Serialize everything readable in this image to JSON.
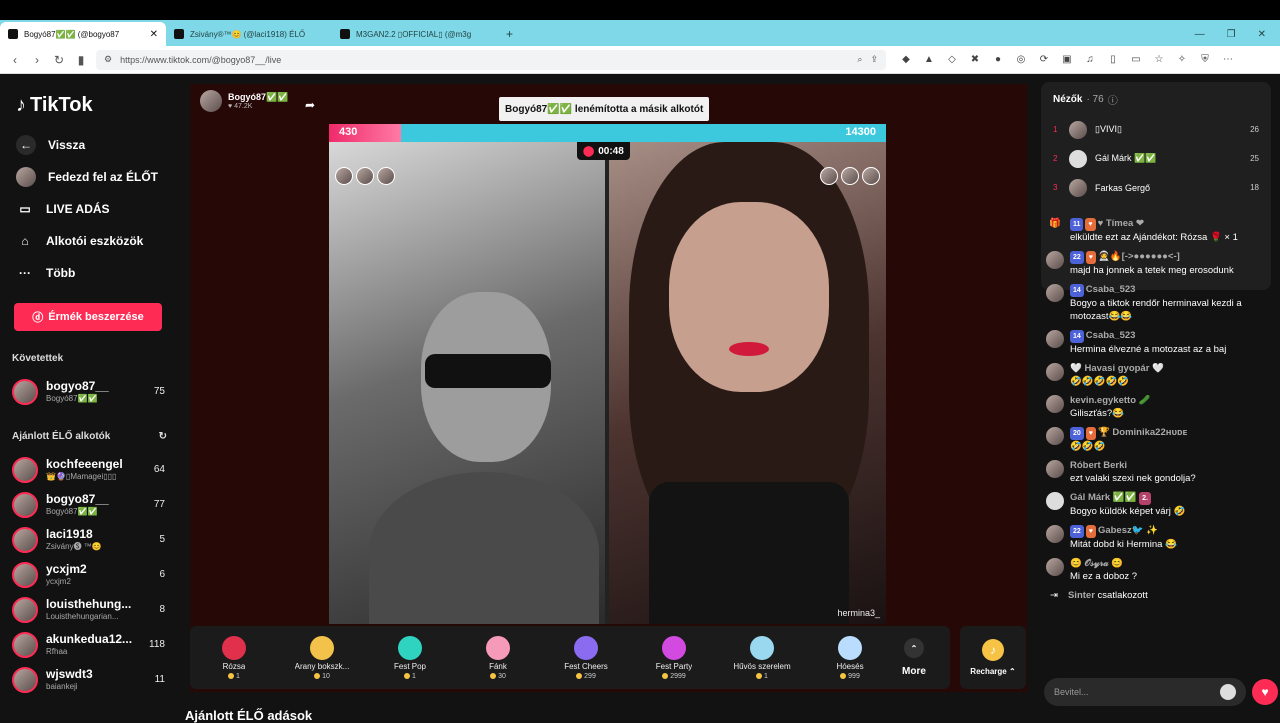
{
  "browser": {
    "tabs": [
      {
        "title": "Bogyó87✅✅ (@bogyo87",
        "active": true
      },
      {
        "title": "Zsivány®™😊 (@laci1918) ÉLŐ",
        "active": false
      },
      {
        "title": "M3GAN2.2 ▯OFFICIAL▯ (@m3g",
        "active": false
      }
    ],
    "url": "https://www.tiktok.com/@bogyo87__/live"
  },
  "sidebar": {
    "logo": "TikTok",
    "nav": [
      {
        "label": "Vissza",
        "icon": "back-arrow-icon"
      },
      {
        "label": "Fedezd fel az ÉLŐT",
        "icon": "avatar"
      },
      {
        "label": "LIVE ADÁS",
        "icon": "video-camera-icon"
      },
      {
        "label": "Alkotói eszközök",
        "icon": "home-tools-icon"
      },
      {
        "label": "Több",
        "icon": "more-dots-icon"
      }
    ],
    "coin_button": "Érmék beszerzése",
    "following_title": "Követettek",
    "following": [
      {
        "name": "bogyo87__",
        "sub": "Bogyó87✅✅",
        "count": "75"
      }
    ],
    "recommended_title": "Ajánlott ÉLŐ alkotók",
    "recommended": [
      {
        "name": "kochfeeengel",
        "sub": "👑🔮▯Mamagei▯▯▯",
        "count": "64"
      },
      {
        "name": "bogyo87__",
        "sub": "Bogyó87✅✅",
        "count": "77"
      },
      {
        "name": "laci1918",
        "sub": "Zsivány🅢 ™😊",
        "count": "5"
      },
      {
        "name": "ycxjm2",
        "sub": "ycxjm2",
        "count": "6"
      },
      {
        "name": "louisthehung...",
        "sub": "Louisthehungarian...",
        "count": "8"
      },
      {
        "name": "akunkedua12...",
        "sub": "Rfhaa",
        "count": "118"
      },
      {
        "name": "wjswdt3",
        "sub": "baiankeji",
        "count": "11"
      }
    ]
  },
  "stream": {
    "host_name": "Bogyó87✅✅",
    "host_likes": "♥ 47.2K",
    "toast": "Bogyó87✅✅ lenémította a másik alkotót",
    "score_left": "430",
    "score_right": "14300",
    "score_left_fraction": 0.03,
    "timer": "00:48",
    "opponent_name": "hermina3_",
    "gifts": [
      {
        "name": "Rózsa",
        "price": "1",
        "color": "#e0304c"
      },
      {
        "name": "Arany bokszk...",
        "price": "10",
        "color": "#f2c24a"
      },
      {
        "name": "Fest Pop",
        "price": "1",
        "color": "#2fd4c0"
      },
      {
        "name": "Fánk",
        "price": "30",
        "color": "#f59ab8"
      },
      {
        "name": "Fest Cheers",
        "price": "299",
        "color": "#8b6cf0"
      },
      {
        "name": "Fest Party",
        "price": "2999",
        "color": "#d24ae0"
      },
      {
        "name": "Hűvös szerelem",
        "price": "1",
        "color": "#9ad8ef"
      },
      {
        "name": "Hóesés",
        "price": "999",
        "color": "#b9dcff"
      }
    ],
    "more_label": "More",
    "recharge_label": "Recharge ⌃",
    "section_below": "Ajánlott ÉLŐ adások"
  },
  "viewers": {
    "title": "Nézők",
    "count": "· 76",
    "top": [
      {
        "rank": "1",
        "name": "▯VIVI▯",
        "score": "26"
      },
      {
        "rank": "2",
        "name": "Gál Márk ✅✅",
        "score": "25"
      },
      {
        "rank": "3",
        "name": "Farkas Gergő",
        "score": "18"
      }
    ]
  },
  "chat": [
    {
      "badges": [
        "11",
        "♥"
      ],
      "user": "♥ Tímea ❤",
      "text": "elküldte ezt az Ajándékot: Rózsa 🌹 × 1"
    },
    {
      "badges": [
        "22",
        "♥"
      ],
      "user": "🧑‍🚀🔥[->●●●●●●<-]",
      "text": "majd ha jonnek a tetek meg erosodunk"
    },
    {
      "badges": [
        "14"
      ],
      "user": "Csaba_523",
      "text": "Bogyo a tiktok rendőr herminaval kezdi a motozast😂😂"
    },
    {
      "badges": [
        "14"
      ],
      "user": "Csaba_523",
      "text": "Hermina élvezné a motozast az a baj"
    },
    {
      "badges": [],
      "user": "🤍 Havasi gyopár 🤍",
      "text": "🤣🤣🤣🤣🤣"
    },
    {
      "badges": [],
      "user": "kevin.egyketto 🥒",
      "text": "Giliszťás?😂"
    },
    {
      "badges": [
        "20",
        "♥"
      ],
      "user": "🏆 Dominika22ʜᴜᴅᴇ",
      "text": "🤣🤣🤣"
    },
    {
      "badges": [],
      "user": "Róbert Berki",
      "text": "ezt valaki szexi nek gondolja?"
    },
    {
      "badges": [
        "2."
      ],
      "user": "Gál Márk ✅✅",
      "text": "Bogyo küldök képet várj 🤣"
    },
    {
      "badges": [
        "22",
        "♥"
      ],
      "user": "Gabesz🐦 ✨",
      "text": "Mitát dobd ki Hermina 😂"
    },
    {
      "badges": [],
      "user": "😊 𝒪𝓈𝓎𝓇𝒶 😊",
      "text": "Mi ez a doboz ?"
    }
  ],
  "joined": {
    "user": "Sinter",
    "text": "csatlakozott"
  },
  "input_placeholder": "Bevitel..."
}
